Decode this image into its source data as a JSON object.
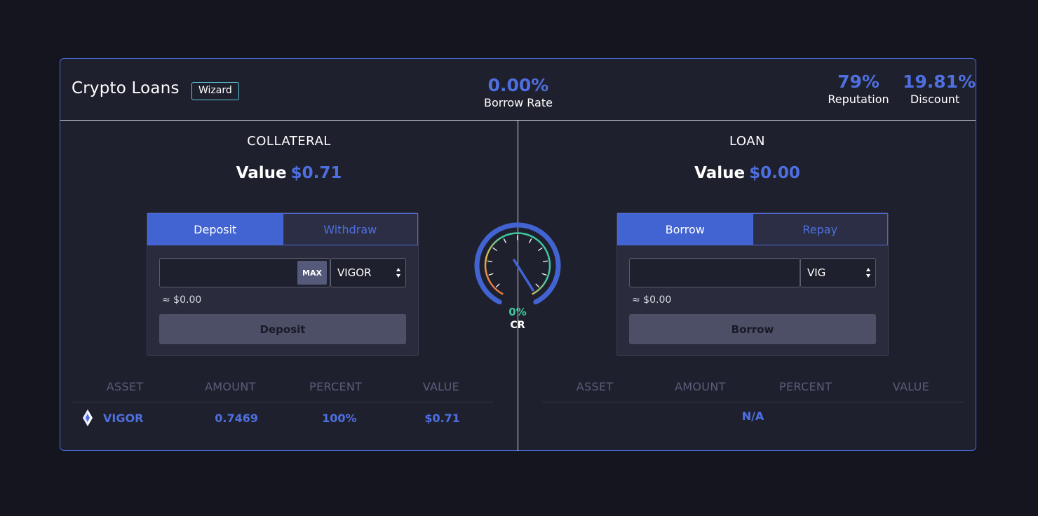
{
  "header": {
    "title": "Crypto Loans",
    "wizard_label": "Wizard",
    "borrow_rate": {
      "value": "0.00%",
      "label": "Borrow Rate"
    },
    "reputation": {
      "value": "79%",
      "label": "Reputation"
    },
    "discount": {
      "value": "19.81%",
      "label": "Discount"
    }
  },
  "collateral": {
    "title": "COLLATERAL",
    "value_label": "Value",
    "value_amount": "$0.71",
    "tabs": [
      {
        "label": "Deposit",
        "active": true
      },
      {
        "label": "Withdraw",
        "active": false
      }
    ],
    "amount_placeholder": "",
    "max_label": "MAX",
    "token_selected": "VIGOR",
    "approx": "≈ $0.00",
    "action_label": "Deposit",
    "table": {
      "headers": [
        "ASSET",
        "AMOUNT",
        "PERCENT",
        "VALUE"
      ],
      "rows": [
        {
          "asset": "VIGOR",
          "amount": "0.7469",
          "percent": "100%",
          "value": "$0.71",
          "icon": "vigor-diamond-icon"
        }
      ]
    }
  },
  "loan": {
    "title": "LOAN",
    "value_label": "Value",
    "value_amount": "$0.00",
    "tabs": [
      {
        "label": "Borrow",
        "active": true
      },
      {
        "label": "Repay",
        "active": false
      }
    ],
    "amount_placeholder": "",
    "token_selected": "VIG",
    "approx": "≈ $0.00",
    "action_label": "Borrow",
    "table": {
      "headers": [
        "ASSET",
        "AMOUNT",
        "PERCENT",
        "VALUE"
      ],
      "empty_text": "N/A"
    }
  },
  "gauge": {
    "percent_text": "0%",
    "label": "CR",
    "needle_value": 0
  },
  "colors": {
    "accent": "#4e6fe0",
    "teal": "#3fc9a0",
    "card_bg": "#1f202d",
    "page_bg": "#15151f"
  }
}
